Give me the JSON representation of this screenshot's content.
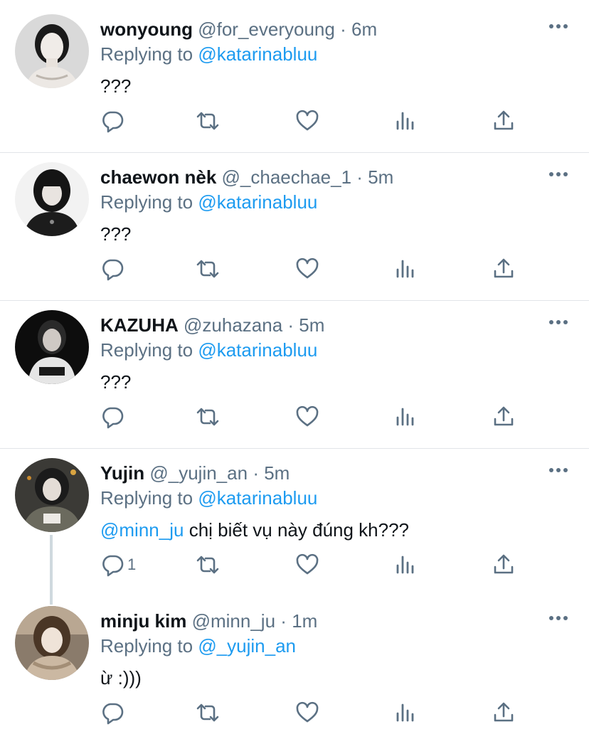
{
  "tweets": [
    {
      "name": "wonyoung",
      "handle": "@for_everyoung",
      "dot": "·",
      "time": "6m",
      "replying_prefix": "Replying to",
      "replying_to": "@katarinabluu",
      "text_mention": "",
      "text": "???",
      "reply_count": "",
      "avatar": "avatar-wonyoung"
    },
    {
      "name": "chaewon nèk",
      "handle": "@_chaechae_1",
      "dot": "·",
      "time": "5m",
      "replying_prefix": "Replying to",
      "replying_to": "@katarinabluu",
      "text_mention": "",
      "text": "???",
      "reply_count": "",
      "avatar": "avatar-chaewon"
    },
    {
      "name": "KAZUHA",
      "handle": "@zuhazana",
      "dot": "·",
      "time": "5m",
      "replying_prefix": "Replying to",
      "replying_to": "@katarinabluu",
      "text_mention": "",
      "text": "???",
      "reply_count": "",
      "avatar": "avatar-kazuha"
    },
    {
      "name": "Yujin",
      "handle": "@_yujin_an",
      "dot": "·",
      "time": "5m",
      "replying_prefix": "Replying to",
      "replying_to": "@katarinabluu",
      "text_mention": "@minn_ju",
      "text": "chị biết vụ này đúng kh???",
      "reply_count": "1",
      "avatar": "avatar-yujin"
    },
    {
      "name": "minju kim",
      "handle": "@minn_ju",
      "dot": "·",
      "time": "1m",
      "replying_prefix": "Replying to",
      "replying_to": "@_yujin_an",
      "text_mention": "",
      "text": "ừ :)))",
      "reply_count": "",
      "avatar": "avatar-minju"
    }
  ],
  "icons": {
    "reply": "reply-icon",
    "retweet": "retweet-icon",
    "like": "like-icon",
    "analytics": "analytics-icon",
    "share": "share-icon",
    "more": "more-icon"
  },
  "colors": {
    "mention": "#1d9bf0",
    "secondary_text": "#5b7083",
    "icon": "#5b7083",
    "divider": "#e1e4e8"
  }
}
